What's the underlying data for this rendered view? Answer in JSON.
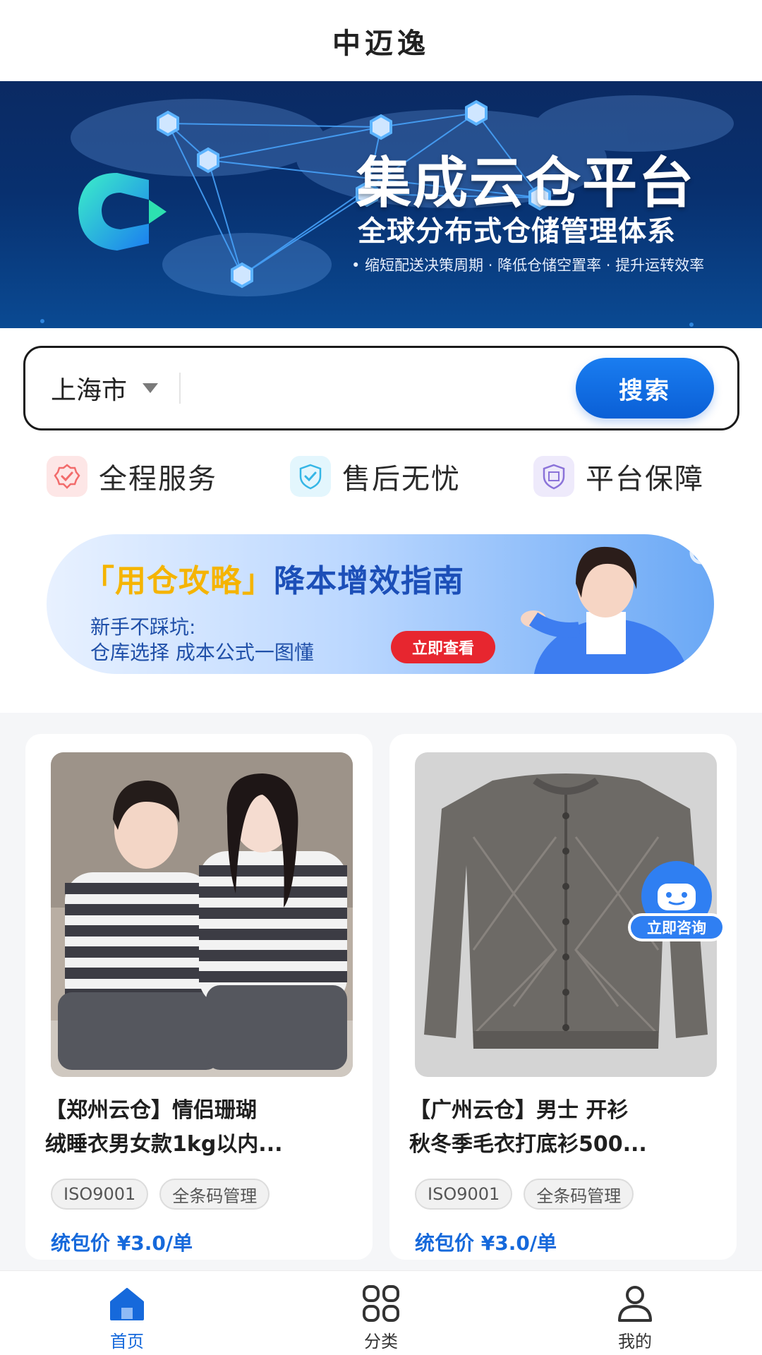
{
  "header": {
    "title": "中迈逸"
  },
  "hero": {
    "headline": "集成云仓平台",
    "subheadline": "全球分布式仓储管理体系",
    "tagline": "• 缩短配送决策周期 · 降低仓储空置率 · 提升运转效率",
    "logo_icon": "c-logo-icon"
  },
  "search": {
    "city": "上海市",
    "placeholder": "",
    "button_label": "搜索"
  },
  "features": [
    {
      "label": "全程服务",
      "icon": "badge-check-icon",
      "color": "#f26b6b"
    },
    {
      "label": "售后无忧",
      "icon": "shield-check-icon",
      "color": "#35b6e6"
    },
    {
      "label": "平台保障",
      "icon": "guarantee-shield-icon",
      "color": "#8b73d9"
    }
  ],
  "promo": {
    "title_highlight": "「用仓攻略」",
    "title_rest": "降本增效指南",
    "line1": "新手不踩坑:",
    "line2": "仓库选择  成本公式一图懂",
    "button_label": "立即查看"
  },
  "products": [
    {
      "name_line1": "【郑州云仓】情侣珊瑚",
      "name_line2": "绒睡衣男女款1kg以内...",
      "tags": [
        "ISO9001",
        "全条码管理"
      ],
      "price": "统包价 ¥3.0/单"
    },
    {
      "name_line1": "【广州云仓】男士 开衫",
      "name_line2": "秋冬季毛衣打底衫500...",
      "tags": [
        "ISO9001",
        "全条码管理"
      ],
      "price": "统包价 ¥3.0/单"
    }
  ],
  "consult": {
    "label": "立即咨询",
    "icon": "chat-bot-icon"
  },
  "tabbar": [
    {
      "label": "首页",
      "icon": "home-icon",
      "active": true
    },
    {
      "label": "分类",
      "icon": "grid-icon",
      "active": false
    },
    {
      "label": "我的",
      "icon": "user-icon",
      "active": false
    }
  ],
  "colors": {
    "accent": "#1669db",
    "promo_button": "#e7262f"
  }
}
